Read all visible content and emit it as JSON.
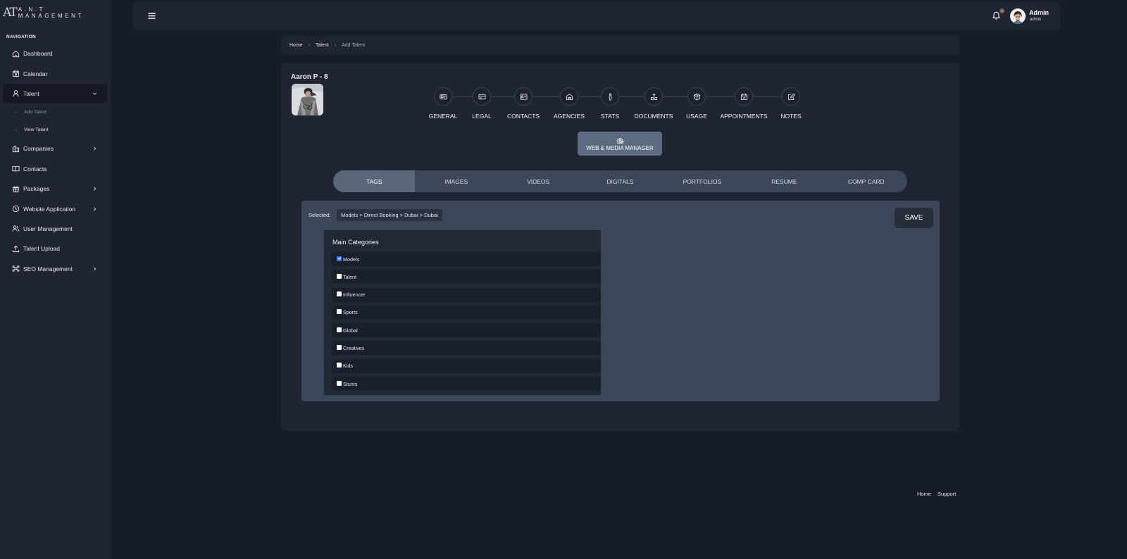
{
  "brand": {
    "mark": "AT",
    "name": "A.N.T MANAGEMENT"
  },
  "sidebar": {
    "heading": "NAVIGATION",
    "items": [
      {
        "label": "Dashboard",
        "icon": "home-icon"
      },
      {
        "label": "Calendar",
        "icon": "calendar-icon"
      },
      {
        "label": "Talent",
        "icon": "user-icon",
        "expanded": true
      },
      {
        "label": "Companies",
        "icon": "building-icon"
      },
      {
        "label": "Contacts",
        "icon": "book-icon"
      },
      {
        "label": "Packages",
        "icon": "gift-icon"
      },
      {
        "label": "Website Application",
        "icon": "clock-icon"
      },
      {
        "label": "User Management",
        "icon": "users-icon"
      },
      {
        "label": "Talent Upload",
        "icon": "upload-icon"
      },
      {
        "label": "SEO Management",
        "icon": "network-icon"
      }
    ],
    "talent_sub": [
      {
        "label": "Add Talent"
      },
      {
        "label": "View Talent"
      }
    ]
  },
  "topbar": {
    "notification_count": "3",
    "user_name": "Admin",
    "user_role": "admin"
  },
  "breadcrumb": {
    "items": [
      "Home",
      "Talent",
      "Add Talent"
    ]
  },
  "talent": {
    "name": "Aaron P - 8"
  },
  "steps": [
    {
      "label": "GENERAL",
      "icon": "id-card-icon"
    },
    {
      "label": "LEGAL",
      "icon": "credit-card-icon"
    },
    {
      "label": "CONTACTS",
      "icon": "contact-card-icon"
    },
    {
      "label": "AGENCIES",
      "icon": "building-icon"
    },
    {
      "label": "STATS",
      "icon": "person-icon"
    },
    {
      "label": "DOCUMENTS",
      "icon": "upload-tray-icon"
    },
    {
      "label": "USAGE",
      "icon": "box-icon"
    },
    {
      "label": "APPOINTMENTS",
      "icon": "calendar-check-icon"
    },
    {
      "label": "NOTES",
      "icon": "edit-icon"
    }
  ],
  "web_media_button": {
    "label": "WEB & MEDIA MANAGER"
  },
  "tabs": {
    "items": [
      "TAGS",
      "IMAGES",
      "VIDEOS",
      "DIGITALS",
      "PORTFOLIOS",
      "RESUME",
      "COMP CARD"
    ],
    "active": "TAGS"
  },
  "tags": {
    "selected_label": "Selected:",
    "selected_value": "Models > Direct Booking > Dubai > Dubai",
    "save_label": "SAVE",
    "main_categories_title": "Main Categories",
    "categories": [
      {
        "label": "Models",
        "checked": true
      },
      {
        "label": "Talent",
        "checked": false
      },
      {
        "label": "Influencer",
        "checked": false
      },
      {
        "label": "Sports",
        "checked": false
      },
      {
        "label": "Global",
        "checked": false
      },
      {
        "label": "Creatives",
        "checked": false
      },
      {
        "label": "Kids",
        "checked": false
      },
      {
        "label": "Stunts",
        "checked": false
      }
    ]
  },
  "footer": {
    "links": [
      "Home",
      "Support"
    ]
  },
  "colors": {
    "background": "#171d28",
    "panel": "#1f2532",
    "tab_bar": "#3d4759",
    "tab_active": "#5a6679",
    "button": "#5d6b80",
    "checkbox_checked": "#3b7be6"
  }
}
